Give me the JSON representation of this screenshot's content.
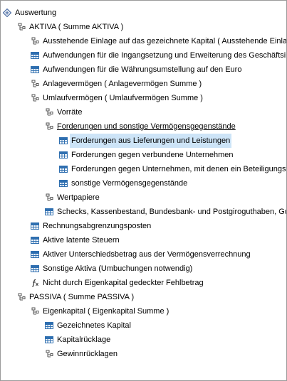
{
  "tree": [
    {
      "label": "Auswertung",
      "icon": "root-report-icon",
      "level": 0
    },
    {
      "label": "AKTIVA ( Summe AKTIVA )",
      "icon": "group-icon",
      "level": 1
    },
    {
      "label": "Ausstehende Einlage auf das gezeichnete Kapital ( Ausstehende Einlag",
      "icon": "group-icon",
      "level": 2
    },
    {
      "label": "Aufwendungen für die Ingangsetzung und Erweiterung des Geschäftsi",
      "icon": "account-icon",
      "level": 2
    },
    {
      "label": "Aufwendungen für die Währungsumstellung auf den Euro",
      "icon": "account-icon",
      "level": 2
    },
    {
      "label": "Anlagevermögen ( Anlagevermögen Summe )",
      "icon": "group-icon",
      "level": 2
    },
    {
      "label": "Umlaufvermögen ( Umlaufvermögen Summe )",
      "icon": "group-icon",
      "level": 2
    },
    {
      "label": "Vorräte",
      "icon": "group-icon",
      "level": 3
    },
    {
      "label": "Forderungen und sonstige Vermögensgegenstände",
      "icon": "group-icon",
      "level": 3,
      "underline": true
    },
    {
      "label": "Forderungen aus Lieferungen und Leistungen",
      "icon": "account-icon",
      "level": 4,
      "selected": true
    },
    {
      "label": "Forderungen gegen verbundene Unternehmen",
      "icon": "account-icon",
      "level": 4
    },
    {
      "label": "Forderungen gegen Unternehmen, mit denen ein Beteiligungsve",
      "icon": "account-icon",
      "level": 4
    },
    {
      "label": "sonstige Vermögensgegenstände",
      "icon": "account-icon",
      "level": 4
    },
    {
      "label": "Wertpapiere",
      "icon": "group-icon",
      "level": 3
    },
    {
      "label": "Schecks, Kassenbestand, Bundesbank- und Postgiroguthaben, Gut",
      "icon": "account-icon",
      "level": 3
    },
    {
      "label": "Rechnungsabgrenzungsposten",
      "icon": "account-icon",
      "level": 2
    },
    {
      "label": "Aktive latente Steuern",
      "icon": "account-icon",
      "level": 2
    },
    {
      "label": "Aktiver Unterschiedsbetrag aus der Vermögensverrechnung",
      "icon": "account-icon",
      "level": 2
    },
    {
      "label": "Sonstige Aktiva (Umbuchungen notwendig)",
      "icon": "account-icon",
      "level": 2
    },
    {
      "label": "Nicht durch Eigenkapital gedeckter Fehlbetrag",
      "icon": "formula-icon",
      "level": 2
    },
    {
      "label": "PASSIVA ( Summe PASSIVA )",
      "icon": "group-icon",
      "level": 1
    },
    {
      "label": "Eigenkapital ( Eigenkapital Summe )",
      "icon": "group-icon",
      "level": 2
    },
    {
      "label": "Gezeichnetes Kapital",
      "icon": "account-icon",
      "level": 3
    },
    {
      "label": "Kapitalrücklage",
      "icon": "account-icon",
      "level": 3
    },
    {
      "label": "Gewinnrücklagen",
      "icon": "group-icon",
      "level": 3
    }
  ],
  "colors": {
    "selection": "#cde4f7",
    "account_icon": "#2f6fb0",
    "border": "#9a9a9a"
  }
}
